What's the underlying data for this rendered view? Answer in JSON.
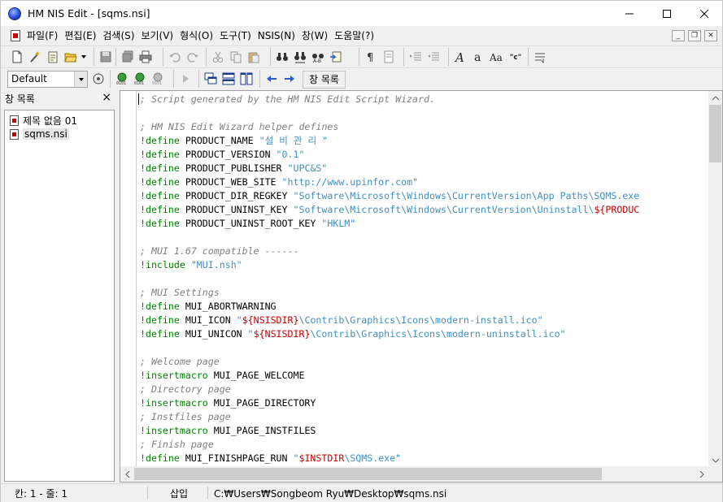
{
  "titlebar": {
    "title": "HM NIS Edit - [sqms.nsi]"
  },
  "menu": {
    "items": [
      "파일(F)",
      "편집(E)",
      "검색(S)",
      "보기(V)",
      "형식(O)",
      "도구(T)",
      "NSIS(N)",
      "창(W)",
      "도움말(?)"
    ]
  },
  "toolbar2": {
    "config_value": "Default",
    "window_list_label": "창 목록"
  },
  "left_pane": {
    "title": "창 목록",
    "files": [
      "제목 없음 01",
      "sqms.nsi"
    ]
  },
  "editor": {
    "lines": [
      [
        {
          "t": "; Script generated by the HM NIS Edit Script Wizard.",
          "c": "comment"
        }
      ],
      [],
      [
        {
          "t": "; HM NIS Edit Wizard helper defines",
          "c": "comment"
        }
      ],
      [
        {
          "t": "!define",
          "c": "kw"
        },
        {
          "t": " PRODUCT_NAME ",
          "c": "id"
        },
        {
          "t": "\"설 비 관 리 \"",
          "c": "str"
        }
      ],
      [
        {
          "t": "!define",
          "c": "kw"
        },
        {
          "t": " PRODUCT_VERSION ",
          "c": "id"
        },
        {
          "t": "\"0.1\"",
          "c": "str"
        }
      ],
      [
        {
          "t": "!define",
          "c": "kw"
        },
        {
          "t": " PRODUCT_PUBLISHER ",
          "c": "id"
        },
        {
          "t": "\"UPC&S\"",
          "c": "str"
        }
      ],
      [
        {
          "t": "!define",
          "c": "kw"
        },
        {
          "t": " PRODUCT_WEB_SITE ",
          "c": "id"
        },
        {
          "t": "\"http://www.upinfor.com\"",
          "c": "str"
        }
      ],
      [
        {
          "t": "!define",
          "c": "kw"
        },
        {
          "t": " PRODUCT_DIR_REGKEY ",
          "c": "id"
        },
        {
          "t": "\"Software\\Microsoft\\Windows\\CurrentVersion\\App Paths\\SQMS.exe",
          "c": "str"
        }
      ],
      [
        {
          "t": "!define",
          "c": "kw"
        },
        {
          "t": " PRODUCT_UNINST_KEY ",
          "c": "id"
        },
        {
          "t": "\"Software\\Microsoft\\Windows\\CurrentVersion\\Uninstall\\",
          "c": "str"
        },
        {
          "t": "${PRODUC",
          "c": "var"
        }
      ],
      [
        {
          "t": "!define",
          "c": "kw"
        },
        {
          "t": " PRODUCT_UNINST_ROOT_KEY ",
          "c": "id"
        },
        {
          "t": "\"HKLM\"",
          "c": "str"
        }
      ],
      [],
      [
        {
          "t": "; MUI 1.67 compatible ------",
          "c": "comment"
        }
      ],
      [
        {
          "t": "!include",
          "c": "kw"
        },
        {
          "t": " ",
          "c": "id"
        },
        {
          "t": "\"MUI.nsh\"",
          "c": "str"
        }
      ],
      [],
      [
        {
          "t": "; MUI Settings",
          "c": "comment"
        }
      ],
      [
        {
          "t": "!define",
          "c": "kw"
        },
        {
          "t": " MUI_ABORTWARNING",
          "c": "id"
        }
      ],
      [
        {
          "t": "!define",
          "c": "kw"
        },
        {
          "t": " MUI_ICON ",
          "c": "id"
        },
        {
          "t": "\"",
          "c": "str"
        },
        {
          "t": "${NSISDIR}",
          "c": "var"
        },
        {
          "t": "\\Contrib\\Graphics\\Icons\\modern-install.ico\"",
          "c": "str"
        }
      ],
      [
        {
          "t": "!define",
          "c": "kw"
        },
        {
          "t": " MUI_UNICON ",
          "c": "id"
        },
        {
          "t": "\"",
          "c": "str"
        },
        {
          "t": "${NSISDIR}",
          "c": "var"
        },
        {
          "t": "\\Contrib\\Graphics\\Icons\\modern-uninstall.ico\"",
          "c": "str"
        }
      ],
      [],
      [
        {
          "t": "; Welcome page",
          "c": "comment"
        }
      ],
      [
        {
          "t": "!insertmacro",
          "c": "kw"
        },
        {
          "t": " MUI_PAGE_WELCOME",
          "c": "id"
        }
      ],
      [
        {
          "t": "; Directory page",
          "c": "comment"
        }
      ],
      [
        {
          "t": "!insertmacro",
          "c": "kw"
        },
        {
          "t": " MUI_PAGE_DIRECTORY",
          "c": "id"
        }
      ],
      [
        {
          "t": "; Instfiles page",
          "c": "comment"
        }
      ],
      [
        {
          "t": "!insertmacro",
          "c": "kw"
        },
        {
          "t": " MUI_PAGE_INSTFILES",
          "c": "id"
        }
      ],
      [
        {
          "t": "; Finish page",
          "c": "comment"
        }
      ],
      [
        {
          "t": "!define",
          "c": "kw"
        },
        {
          "t": " MUI_FINISHPAGE_RUN ",
          "c": "id"
        },
        {
          "t": "\"",
          "c": "str"
        },
        {
          "t": "$INSTDIR",
          "c": "var"
        },
        {
          "t": "\\SQMS.exe\"",
          "c": "str"
        }
      ]
    ]
  },
  "statusbar": {
    "position": "칸: 1 - 줄: 1",
    "mode": "삽입",
    "path": "C:₩Users₩Songbeom Ryu₩Desktop₩sqms.nsi"
  },
  "colors": {
    "comment": "#808080",
    "keyword": "#008000",
    "string": "#4090c0",
    "variable": "#c00000"
  }
}
